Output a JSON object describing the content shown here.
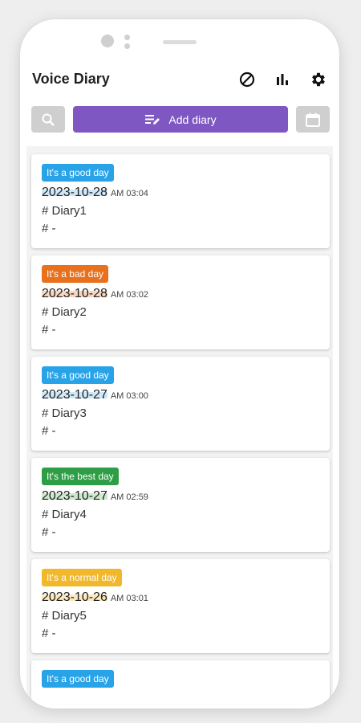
{
  "app": {
    "title": "Voice Diary"
  },
  "header_icons": [
    {
      "name": "block-icon"
    },
    {
      "name": "bar-chart-icon"
    },
    {
      "name": "gear-icon"
    }
  ],
  "toolbar": {
    "search_icon": "search-icon",
    "add_label": "Add diary",
    "add_icon": "edit-list-icon",
    "calendar_icon": "calendar-icon"
  },
  "colors": {
    "primary": "#7e57c2",
    "good": "#29a3e8",
    "bad": "#e8711e",
    "best": "#2e9e46",
    "normal": "#f0b82a"
  },
  "entries": [
    {
      "mood": "It's a good day",
      "mood_color": "#29a3e8",
      "highlight": "#cfe8f8",
      "date": "2023-10-28",
      "time": "AM 03:04",
      "title": "# Diary1",
      "tag": "# -"
    },
    {
      "mood": "It's a bad day",
      "mood_color": "#e8711e",
      "highlight": "#f8d7c0",
      "date": "2023-10-28",
      "time": "AM 03:02",
      "title": "# Diary2",
      "tag": "# -"
    },
    {
      "mood": "It's a good day",
      "mood_color": "#29a3e8",
      "highlight": "#cfe8f8",
      "date": "2023-10-27",
      "time": "AM 03:00",
      "title": "# Diary3",
      "tag": "# -"
    },
    {
      "mood": "It's the best day",
      "mood_color": "#2e9e46",
      "highlight": "#cdeacd",
      "date": "2023-10-27",
      "time": "AM 02:59",
      "title": "# Diary4",
      "tag": "# -"
    },
    {
      "mood": "It's a normal day",
      "mood_color": "#f0b82a",
      "highlight": "#fbe9bf",
      "date": "2023-10-26",
      "time": "AM 03:01",
      "title": "# Diary5",
      "tag": "# -"
    },
    {
      "mood": "It's a good day",
      "mood_color": "#29a3e8",
      "highlight": "#cfe8f8",
      "date": "",
      "time": "",
      "title": "",
      "tag": ""
    }
  ]
}
